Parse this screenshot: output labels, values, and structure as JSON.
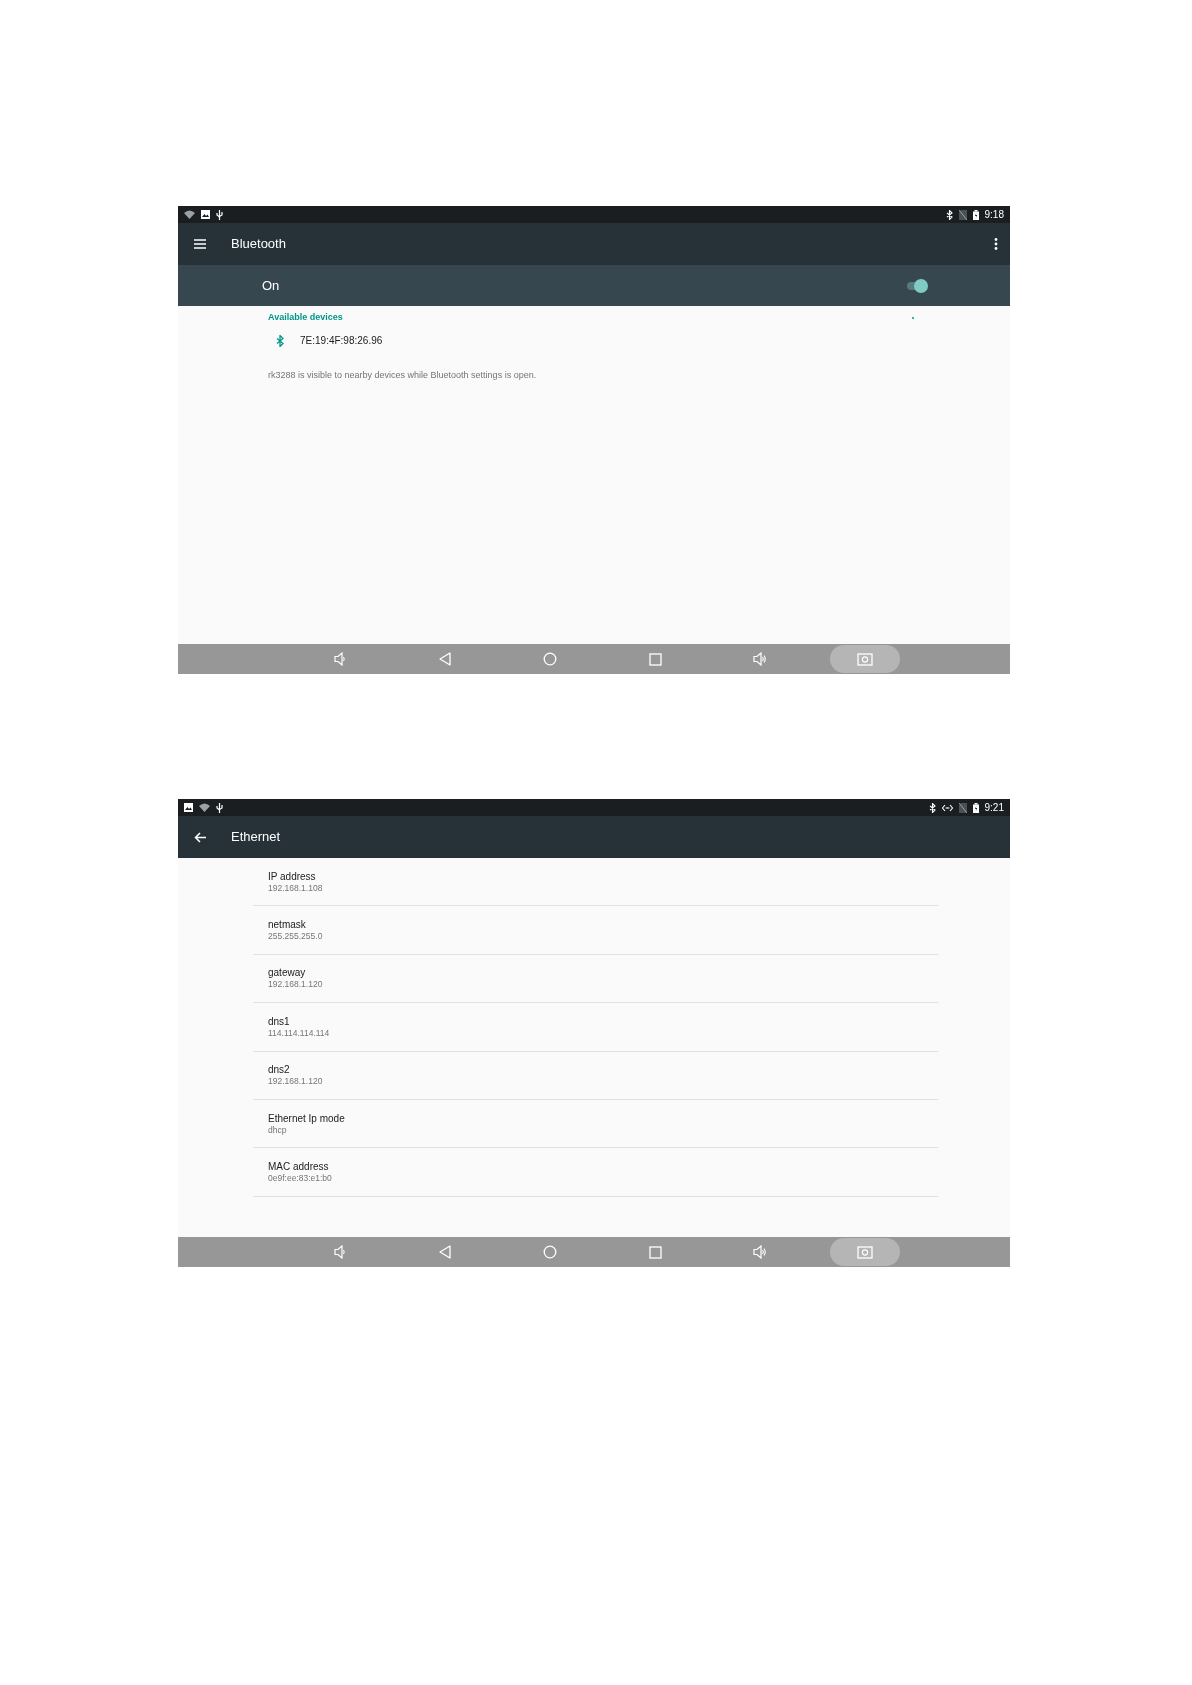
{
  "screens": [
    {
      "status_bar": {
        "left_icons": [
          {
            "kind": "wifi"
          },
          {
            "kind": "image"
          },
          {
            "kind": "usb"
          }
        ],
        "right_icons": [
          {
            "kind": "bluetooth"
          },
          {
            "kind": "no-sim"
          },
          {
            "kind": "battery"
          }
        ],
        "time": "9:18"
      },
      "toolbar": {
        "nav_button": {
          "kind": "menu"
        },
        "title": "Bluetooth",
        "overflow_menu": true
      },
      "switch_bar": {
        "label": "On",
        "on": true
      },
      "content": {
        "kind": "bluetooth",
        "section_header": "Available devices",
        "scanning": true,
        "devices": [
          {
            "name": "7E:19:4F:98:26.96"
          }
        ],
        "footer": "rk3288 is visible to nearby devices while Bluetooth settings is open."
      },
      "nav_bar": [
        {
          "kind": "volume-down",
          "pressed": false
        },
        {
          "kind": "back",
          "pressed": false
        },
        {
          "kind": "home",
          "pressed": false
        },
        {
          "kind": "recents",
          "pressed": false
        },
        {
          "kind": "volume-up",
          "pressed": false
        },
        {
          "kind": "screenshot",
          "pressed": true
        }
      ]
    },
    {
      "status_bar": {
        "left_icons": [
          {
            "kind": "image"
          },
          {
            "kind": "wifi"
          },
          {
            "kind": "usb"
          }
        ],
        "right_icons": [
          {
            "kind": "bluetooth"
          },
          {
            "kind": "ethernet"
          },
          {
            "kind": "no-sim"
          },
          {
            "kind": "battery"
          }
        ],
        "time": "9:21"
      },
      "toolbar": {
        "nav_button": {
          "kind": "back"
        },
        "title": "Ethernet",
        "overflow_menu": false
      },
      "content": {
        "kind": "list",
        "items": [
          {
            "title": "IP address",
            "value": "192.168.1.108"
          },
          {
            "title": "netmask",
            "value": "255.255.255.0"
          },
          {
            "title": "gateway",
            "value": "192.168.1.120"
          },
          {
            "title": "dns1",
            "value": "114.114.114.114"
          },
          {
            "title": "dns2",
            "value": "192.168.1.120"
          },
          {
            "title": "Ethernet Ip mode",
            "value": "dhcp"
          },
          {
            "title": "MAC address",
            "value": "0e9f:ee:83:e1:b0"
          }
        ]
      },
      "nav_bar": [
        {
          "kind": "volume-down",
          "pressed": false
        },
        {
          "kind": "back",
          "pressed": false
        },
        {
          "kind": "home",
          "pressed": false
        },
        {
          "kind": "recents",
          "pressed": false
        },
        {
          "kind": "volume-up",
          "pressed": false
        },
        {
          "kind": "screenshot",
          "pressed": true
        }
      ]
    }
  ]
}
